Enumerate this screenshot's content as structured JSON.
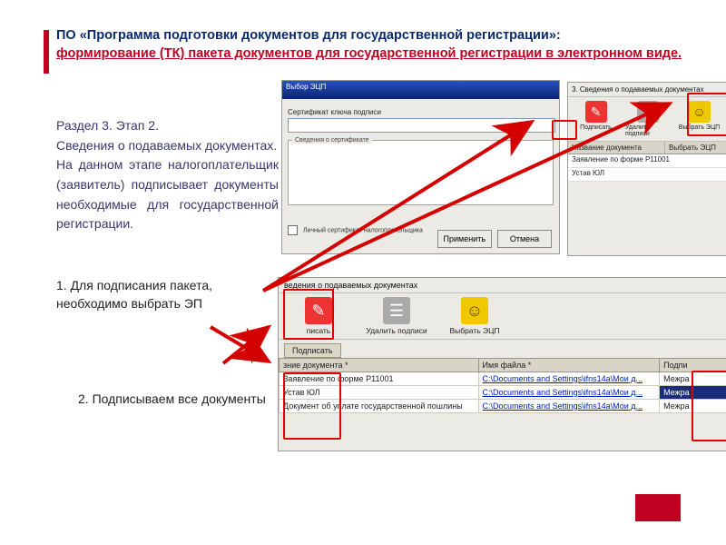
{
  "title": {
    "line1": "ПО «Программа подготовки документов для государственной регистрации»:",
    "line2": "формирование (ТК) пакета документов для государственной регистрации в электронном виде."
  },
  "section": {
    "heading": "Раздел 3. Этап 2.",
    "line1": "Сведения о подаваемых документах.",
    "body": "На данном этапе налогоплательщик (заявитель) подписывает документы необходимые для государственной регистрации."
  },
  "instr1": {
    "num": "1.",
    "text": "Для подписания пакета, необходимо выбрать ЭП"
  },
  "instr2": {
    "text": "2. Подписываем все документы"
  },
  "dlg1": {
    "title": "Выбор ЭЦП",
    "label_cert": "Сертификат ключа подписи",
    "fieldset_label": "Сведения о сертификате",
    "checkbox_label": "Личный сертификат налогоплательщика",
    "btn_apply": "Применить",
    "btn_cancel": "Отмена"
  },
  "pnl2": {
    "header": "3. Сведения о подаваемых документах",
    "toolbar": {
      "sign": "Подписать",
      "del": "Удалить подписи",
      "sel": "Выбрать ЭЦП"
    },
    "col1": "Название документа",
    "col2": "Выбрать ЭЦП",
    "rows": [
      "Заявление по форме Р11001",
      "Устав ЮЛ"
    ]
  },
  "pnl3": {
    "header": "ведения о подаваемых документах",
    "toolbar": {
      "sign": "писать",
      "del": "Удалить подписи",
      "sel": "Выбрать ЭЦП"
    },
    "filter": "Подписать",
    "th1": "зние документа *",
    "th2": "Имя файла *",
    "th3": "Подпи",
    "filecell": "C:\\Documents and Settings\\ifns14a\\Мои д...",
    "signcell": "Межра",
    "rows": {
      "r1": "Заявление по форме Р11001",
      "r2": "Устав ЮЛ",
      "r3": "Документ об уплате государственной пошлины"
    }
  }
}
